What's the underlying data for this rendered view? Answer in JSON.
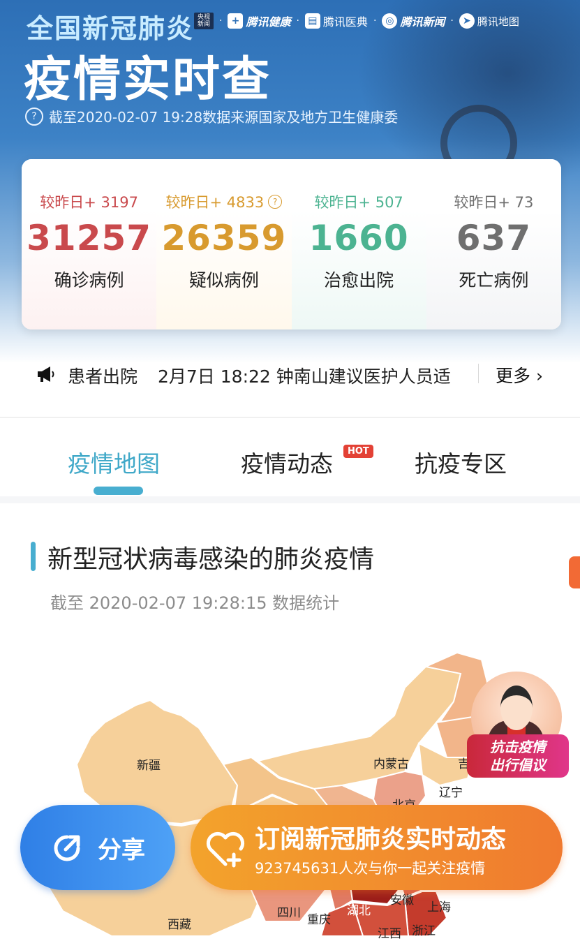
{
  "header": {
    "title_small": "全国新冠肺炎",
    "title_big": "疫情实时查",
    "partners": {
      "cctv": "央视新闻",
      "tencent_health": "腾讯健康",
      "tencent_dict": "腾讯医典",
      "tencent_news": "腾讯新闻",
      "tencent_map": "腾讯地图"
    },
    "info_text": "截至2020-02-07 19:28数据来源国家及地方卫生健康委"
  },
  "stats": [
    {
      "delta": "较昨日+ 3197",
      "value": "31257",
      "label": "确诊病例",
      "color": "#c9494c"
    },
    {
      "delta": "较昨日+ 4833",
      "value": "26359",
      "label": "疑似病例",
      "color": "#d89a2e"
    },
    {
      "delta": "较昨日+ 507",
      "value": "1660",
      "label": "治愈出院",
      "color": "#4cb391"
    },
    {
      "delta": "较昨日+ 73",
      "value": "637",
      "label": "死亡病例",
      "color": "#6f6f6f"
    }
  ],
  "news": {
    "tag": "患者出院",
    "text": "2月7日 18:22 钟南山建议医护人员适",
    "more": "更多"
  },
  "tabs": [
    {
      "label": "疫情地图",
      "active": true
    },
    {
      "label": "疫情动态",
      "badge": "HOT"
    },
    {
      "label": "抗疫专区"
    }
  ],
  "section": {
    "title": "新型冠状病毒感染的肺炎疫情",
    "subtitle": "截至 2020-02-07 19:28:15 数据统计"
  },
  "map": {
    "labels": [
      "新疆",
      "内蒙古",
      "吉",
      "辽宁",
      "北京",
      "西藏",
      "四川",
      "重庆",
      "湖北",
      "安徽",
      "上海",
      "江西",
      "浙江"
    ]
  },
  "promo": {
    "line1": "抗击疫情",
    "line2": "出行倡议"
  },
  "actions": {
    "share": "分享",
    "subscribe_title": "订阅新冠肺炎实时动态",
    "subscribe_desc": "923745631人次与你一起关注疫情"
  }
}
